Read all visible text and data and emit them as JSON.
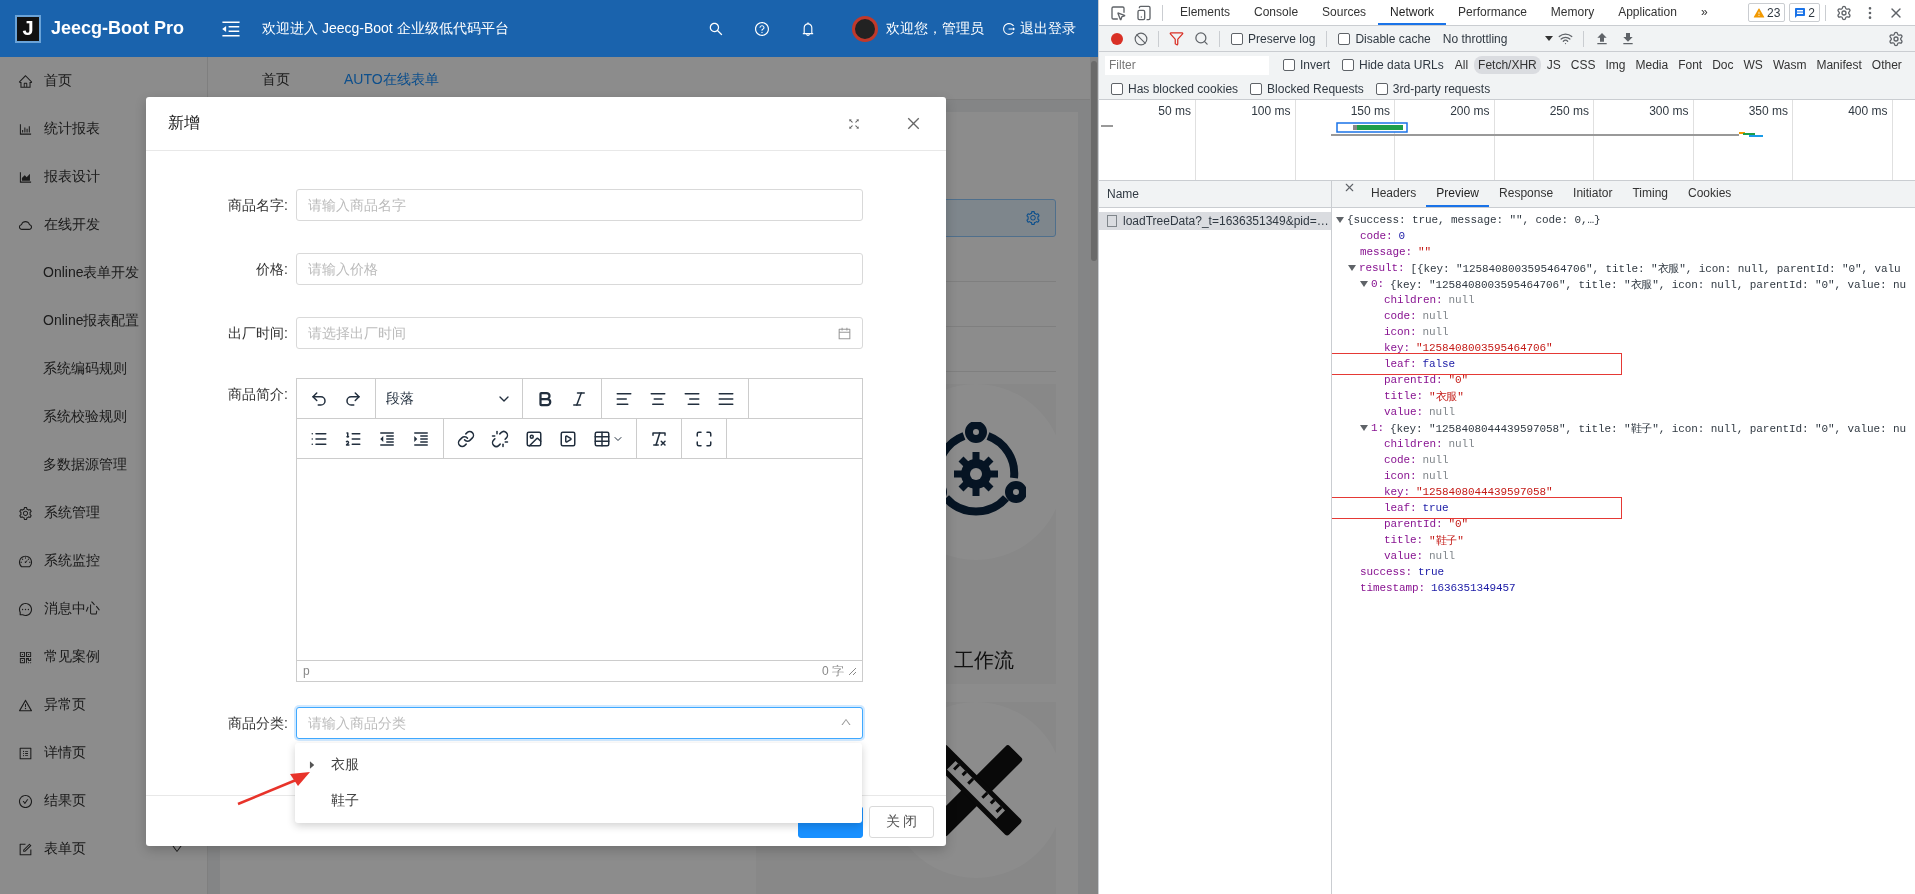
{
  "app": {
    "logo_letter": "J",
    "brand": "Jeecg-Boot Pro",
    "welcome": "欢迎进入 Jeecg-Boot 企业级低代码平台",
    "greeting": "欢迎您，管理员",
    "logout": "退出登录"
  },
  "sidebar": {
    "items": [
      {
        "kind": "home",
        "label": "首页"
      },
      {
        "kind": "bar",
        "label": "统计报表"
      },
      {
        "kind": "area",
        "label": "报表设计"
      },
      {
        "kind": "cloud",
        "label": "在线开发",
        "children": [
          {
            "label": "Online表单开发"
          },
          {
            "label": "Online报表配置"
          },
          {
            "label": "系统编码规则"
          },
          {
            "label": "系统校验规则"
          },
          {
            "label": "多数据源管理"
          }
        ]
      },
      {
        "kind": "setting",
        "label": "系统管理"
      },
      {
        "kind": "dashboard",
        "label": "系统监控"
      },
      {
        "kind": "message",
        "label": "消息中心"
      },
      {
        "kind": "qrcode",
        "label": "常见案例"
      },
      {
        "kind": "warning",
        "label": "异常页"
      },
      {
        "kind": "profile",
        "label": "详情页"
      },
      {
        "kind": "check",
        "label": "结果页"
      },
      {
        "kind": "form",
        "label": "表单页",
        "expanded": false
      }
    ]
  },
  "page_tabs": [
    {
      "label": "首页",
      "selected": false
    },
    {
      "label": "AUTO在线表单",
      "selected": true
    }
  ],
  "content": {
    "tile_label": "工作流"
  },
  "modal": {
    "title": "新增",
    "fields": [
      {
        "kind": "text",
        "label": "商品名字:",
        "placeholder": "请输入商品名字"
      },
      {
        "kind": "text",
        "label": "价格:",
        "placeholder": "请输入价格"
      },
      {
        "kind": "date",
        "label": "出厂时间:",
        "placeholder": "请选择出厂时间"
      },
      {
        "kind": "editor",
        "label": "商品简介:",
        "format": "段落",
        "status_path": "p",
        "word_count": "0 字"
      },
      {
        "kind": "tree_select",
        "label": "商品分类:",
        "placeholder": "请输入商品分类",
        "expanded": true,
        "options": [
          {
            "label": "衣服",
            "expandable": true
          },
          {
            "label": "鞋子",
            "expandable": false
          }
        ]
      }
    ],
    "buttons": [
      {
        "kind": "primary"
      },
      {
        "kind": "default",
        "label": "关 闭"
      }
    ]
  },
  "devtools": {
    "tabs": [
      {
        "label": "Elements",
        "selected": false
      },
      {
        "label": "Console",
        "selected": false
      },
      {
        "label": "Sources",
        "selected": false
      },
      {
        "label": "Network",
        "selected": true
      },
      {
        "label": "Performance",
        "selected": false
      },
      {
        "label": "Memory",
        "selected": false
      },
      {
        "label": "Application",
        "selected": false
      }
    ],
    "more": "»",
    "warning_count": "23",
    "message_count": "2",
    "preserve_log": {
      "label": "Preserve log",
      "checked": false
    },
    "disable_cache": {
      "label": "Disable cache",
      "checked": false
    },
    "throttling": "No throttling",
    "filter_placeholder": "Filter",
    "filter_options": [
      {
        "label": "Invert",
        "checked": false
      },
      {
        "label": "Hide data URLs",
        "checked": false
      }
    ],
    "type_filters": [
      {
        "label": "All",
        "selected": false
      },
      {
        "label": "Fetch/XHR",
        "selected": true
      },
      {
        "label": "JS",
        "selected": false
      },
      {
        "label": "CSS",
        "selected": false
      },
      {
        "label": "Img",
        "selected": false
      },
      {
        "label": "Media",
        "selected": false
      },
      {
        "label": "Font",
        "selected": false
      },
      {
        "label": "Doc",
        "selected": false
      },
      {
        "label": "WS",
        "selected": false
      },
      {
        "label": "Wasm",
        "selected": false
      },
      {
        "label": "Manifest",
        "selected": false
      },
      {
        "label": "Other",
        "selected": false
      }
    ],
    "more_options": [
      {
        "label": "Has blocked cookies",
        "checked": false
      },
      {
        "label": "Blocked Requests",
        "checked": false
      },
      {
        "label": "3rd-party requests",
        "checked": false
      }
    ],
    "timeline_ticks": [
      "50 ms",
      "100 ms",
      "150 ms",
      "200 ms",
      "250 ms",
      "300 ms",
      "350 ms",
      "400 ms"
    ],
    "name_header": "Name",
    "requests": [
      {
        "name": "loadTreeData?_t=1636351349&pid=…",
        "selected": true
      }
    ],
    "detail_tabs": [
      {
        "label": "Headers",
        "selected": false
      },
      {
        "label": "Preview",
        "selected": true
      },
      {
        "label": "Response",
        "selected": false
      },
      {
        "label": "Initiator",
        "selected": false
      },
      {
        "label": "Timing",
        "selected": false
      },
      {
        "label": "Cookies",
        "selected": false
      }
    ],
    "preview": {
      "kind": "object",
      "summary": "{success: true, message: \"\", code: 0,…}",
      "expanded": true,
      "highlighted": false,
      "children": [
        {
          "kind": "number",
          "key": "code:",
          "value": "0",
          "highlighted": false
        },
        {
          "kind": "string",
          "key": "message:",
          "value": "\"\"",
          "highlighted": false
        },
        {
          "kind": "array",
          "key": "result:",
          "summary": "[{key: \"1258408003595464706\", title: \"衣服\", icon: null, parentId: \"0\", valu",
          "expanded": true,
          "highlighted": false,
          "children": [
            {
              "kind": "object",
              "key": "0:",
              "summary": "{key: \"1258408003595464706\", title: \"衣服\", icon: null, parentId: \"0\", value: nu",
              "expanded": true,
              "highlighted": false,
              "children": [
                {
                  "kind": "null",
                  "key": "children:",
                  "value": "null",
                  "highlighted": false
                },
                {
                  "kind": "null",
                  "key": "code:",
                  "value": "null",
                  "highlighted": false
                },
                {
                  "kind": "null",
                  "key": "icon:",
                  "value": "null",
                  "highlighted": false
                },
                {
                  "kind": "string",
                  "key": "key:",
                  "value": "\"1258408003595464706\"",
                  "highlighted": false
                },
                {
                  "kind": "number",
                  "key": "leaf:",
                  "value": "false",
                  "highlighted": true
                },
                {
                  "kind": "string",
                  "key": "parentId:",
                  "value": "\"0\"",
                  "highlighted": false
                },
                {
                  "kind": "string",
                  "key": "title:",
                  "value": "\"衣服\"",
                  "highlighted": false
                },
                {
                  "kind": "null",
                  "key": "value:",
                  "value": "null",
                  "highlighted": false
                }
              ]
            },
            {
              "kind": "object",
              "key": "1:",
              "summary": "{key: \"1258408044439597058\", title: \"鞋子\", icon: null, parentId: \"0\", value: nu",
              "expanded": true,
              "highlighted": false,
              "children": [
                {
                  "kind": "null",
                  "key": "children:",
                  "value": "null",
                  "highlighted": false
                },
                {
                  "kind": "null",
                  "key": "code:",
                  "value": "null",
                  "highlighted": false
                },
                {
                  "kind": "null",
                  "key": "icon:",
                  "value": "null",
                  "highlighted": false
                },
                {
                  "kind": "string",
                  "key": "key:",
                  "value": "\"1258408044439597058\"",
                  "highlighted": false
                },
                {
                  "kind": "number",
                  "key": "leaf:",
                  "value": "true",
                  "highlighted": true
                },
                {
                  "kind": "string",
                  "key": "parentId:",
                  "value": "\"0\"",
                  "highlighted": false
                },
                {
                  "kind": "string",
                  "key": "title:",
                  "value": "\"鞋子\"",
                  "highlighted": false
                },
                {
                  "kind": "null",
                  "key": "value:",
                  "value": "null",
                  "highlighted": false
                }
              ]
            }
          ]
        },
        {
          "kind": "number",
          "key": "success:",
          "value": "true",
          "highlighted": false
        },
        {
          "kind": "number",
          "key": "timestamp:",
          "value": "1636351349457",
          "highlighted": false
        }
      ]
    }
  }
}
